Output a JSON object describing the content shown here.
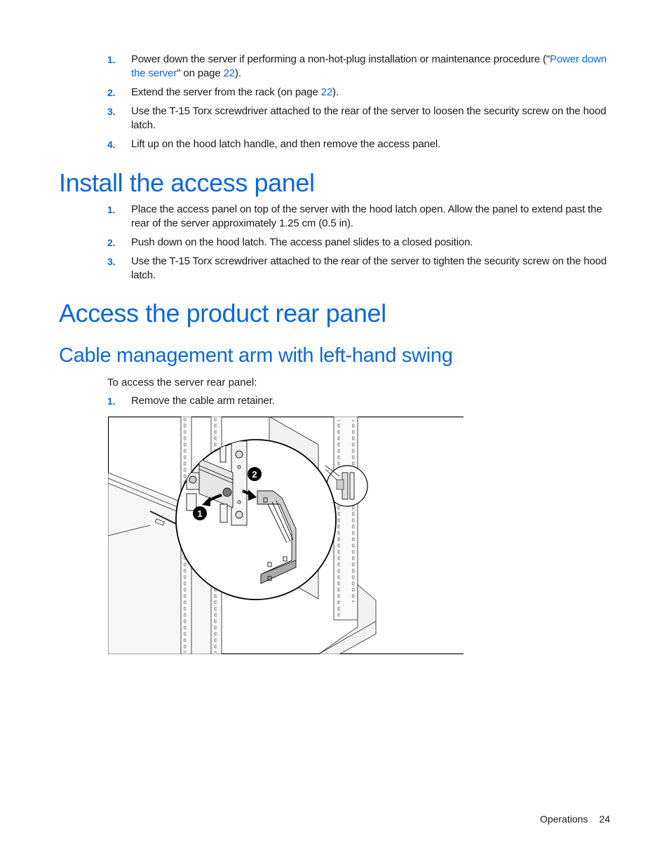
{
  "intro_steps": [
    {
      "number": "1.",
      "text_before": "Power down the server if performing a non-hot-plug installation or maintenance procedure (\"",
      "link_text": "Power down the server",
      "text_middle": "\" on page ",
      "page_link": "22",
      "text_after": ")."
    },
    {
      "number": "2.",
      "text_before": "Extend the server from the rack (on page ",
      "page_link": "22",
      "text_after": ")."
    },
    {
      "number": "3.",
      "text": "Use the T-15 Torx screwdriver attached to the rear of the server to loosen the security screw on the hood latch."
    },
    {
      "number": "4.",
      "text": "Lift up on the hood latch handle, and then remove the access panel."
    }
  ],
  "section_install": {
    "title": "Install the access panel",
    "steps": [
      {
        "number": "1.",
        "text": "Place the access panel on top of the server with the hood latch open. Allow the panel to extend past the rear of the server approximately 1.25 cm (0.5 in)."
      },
      {
        "number": "2.",
        "text": "Push down on the hood latch. The access panel slides to a closed position."
      },
      {
        "number": "3.",
        "text": "Use the T-15 Torx screwdriver attached to the rear of the server to tighten the security screw on the hood latch."
      }
    ]
  },
  "section_rear": {
    "title": "Access the product rear panel",
    "subsection": {
      "title": "Cable management arm with left-hand swing",
      "intro": "To access the server rear panel:",
      "steps": [
        {
          "number": "1.",
          "text": "Remove the cable arm retainer."
        }
      ],
      "figure": {
        "callouts": [
          "1",
          "2"
        ],
        "description": "Illustration of removing the cable arm retainer from the rack rail"
      }
    }
  },
  "footer": {
    "section": "Operations",
    "page": "24"
  },
  "colors": {
    "accent": "#0d67d6",
    "text": "#1a1a1a"
  }
}
